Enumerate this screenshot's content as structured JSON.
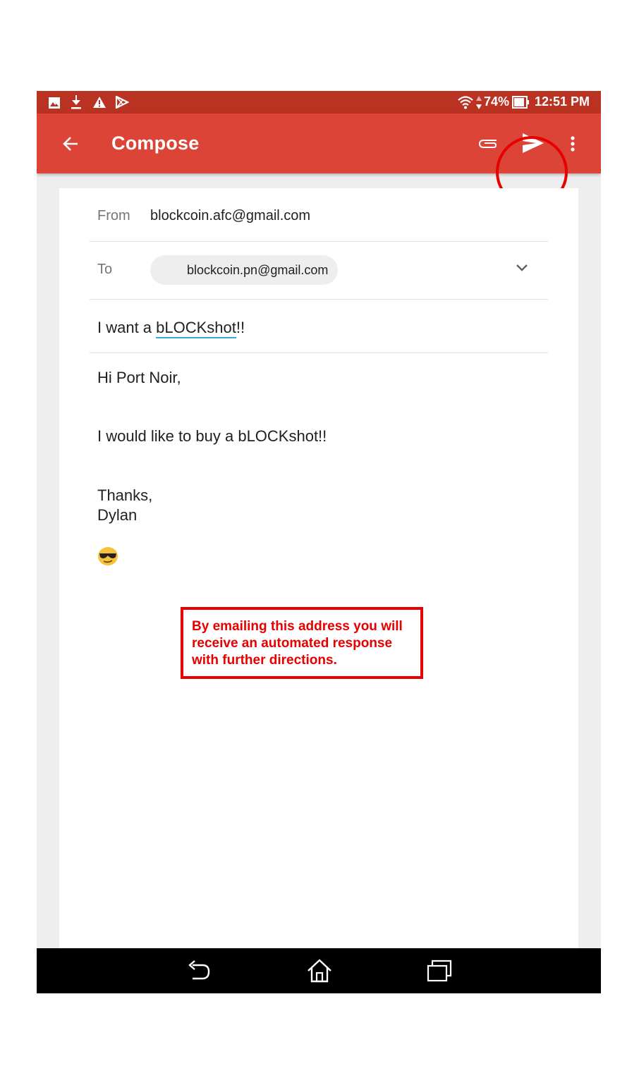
{
  "status_bar": {
    "battery": "74%",
    "time": "12:51 PM",
    "icons": [
      "image-icon",
      "download-icon",
      "warning-icon",
      "play-store-icon",
      "wifi-icon",
      "data-arrows-icon",
      "battery-icon"
    ]
  },
  "app_bar": {
    "title": "Compose",
    "icons": [
      "back-arrow-icon",
      "attach-icon",
      "send-icon",
      "more-vert-icon"
    ]
  },
  "compose": {
    "from_label": "From",
    "from_value": "blockcoin.afc@gmail.com",
    "to_label": "To",
    "to_chip": "blockcoin.pn@gmail.com",
    "subject_prefix": "I want a ",
    "subject_word": "bLOCKshot",
    "subject_suffix": "!!",
    "body": {
      "greeting": "Hi Port Noir,",
      "line1": "I would like to buy a bLOCKshot!!",
      "closing": "Thanks,",
      "signature": "Dylan",
      "emoji": "cool-sunglasses-emoji"
    }
  },
  "annotation": {
    "text": "By emailing this address you will receive an automated response with further directions.",
    "color": "#e60000"
  },
  "nav_bar": {
    "icons": [
      "back-icon",
      "home-icon",
      "recents-icon"
    ]
  },
  "colors": {
    "status_bar": "#b93222",
    "app_bar": "#db4437",
    "highlight": "#e60000"
  }
}
